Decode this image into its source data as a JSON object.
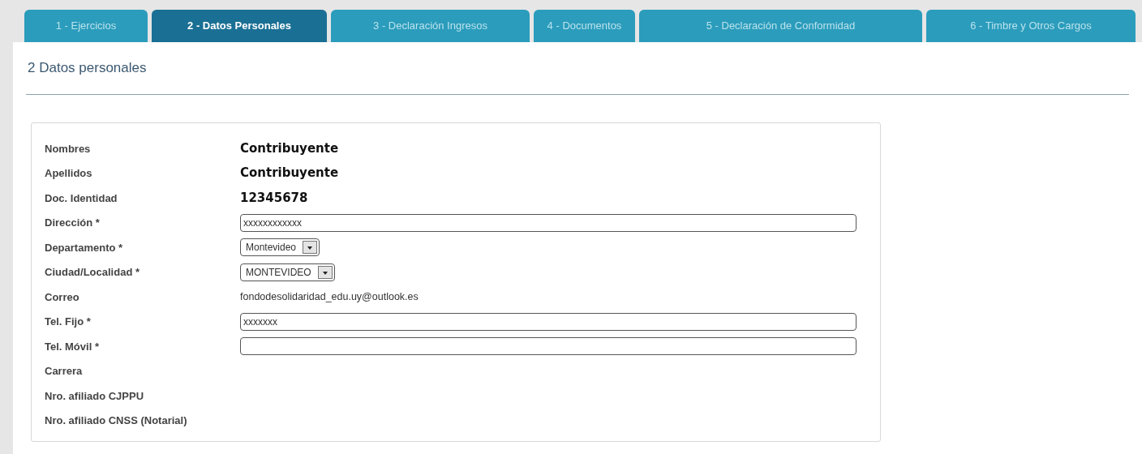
{
  "tabs": [
    {
      "label": "1 - Ejercicios",
      "selected": false
    },
    {
      "label": "2 - Datos Personales",
      "selected": true
    },
    {
      "label": "3 - Declaración Ingresos",
      "selected": false
    },
    {
      "label": "4 - Documentos",
      "selected": false
    },
    {
      "label": "5 - Declaración de Conformidad",
      "selected": false
    },
    {
      "label": "6 - Timbre y Otros Cargos",
      "selected": false
    }
  ],
  "section_title": "2 Datos personales",
  "fields": [
    {
      "label": "Nombres",
      "kind": "bold",
      "value": "Contribuyente"
    },
    {
      "label": "Apellidos",
      "kind": "bold",
      "value": "Contribuyente"
    },
    {
      "label": "Doc. Identidad",
      "kind": "bold",
      "value": "12345678"
    },
    {
      "label": "Dirección *",
      "kind": "input",
      "value": "xxxxxxxxxxxx"
    },
    {
      "label": "Departamento *",
      "kind": "select",
      "value": "Montevideo"
    },
    {
      "label": "Ciudad/Localidad *",
      "kind": "select",
      "value": "MONTEVIDEO"
    },
    {
      "label": "Correo",
      "kind": "plain",
      "value": "fondodesolidaridad_edu.uy@outlook.es"
    },
    {
      "label": "Tel. Fijo *",
      "kind": "input",
      "value": "xxxxxxx"
    },
    {
      "label": "Tel. Móvil *",
      "kind": "input"
    },
    {
      "label": "Carrera",
      "kind": "empty"
    },
    {
      "label": "Nro. afiliado CJPPU",
      "kind": "empty"
    },
    {
      "label": "Nro. afiliado CNSS (Notarial)",
      "kind": "empty"
    }
  ]
}
